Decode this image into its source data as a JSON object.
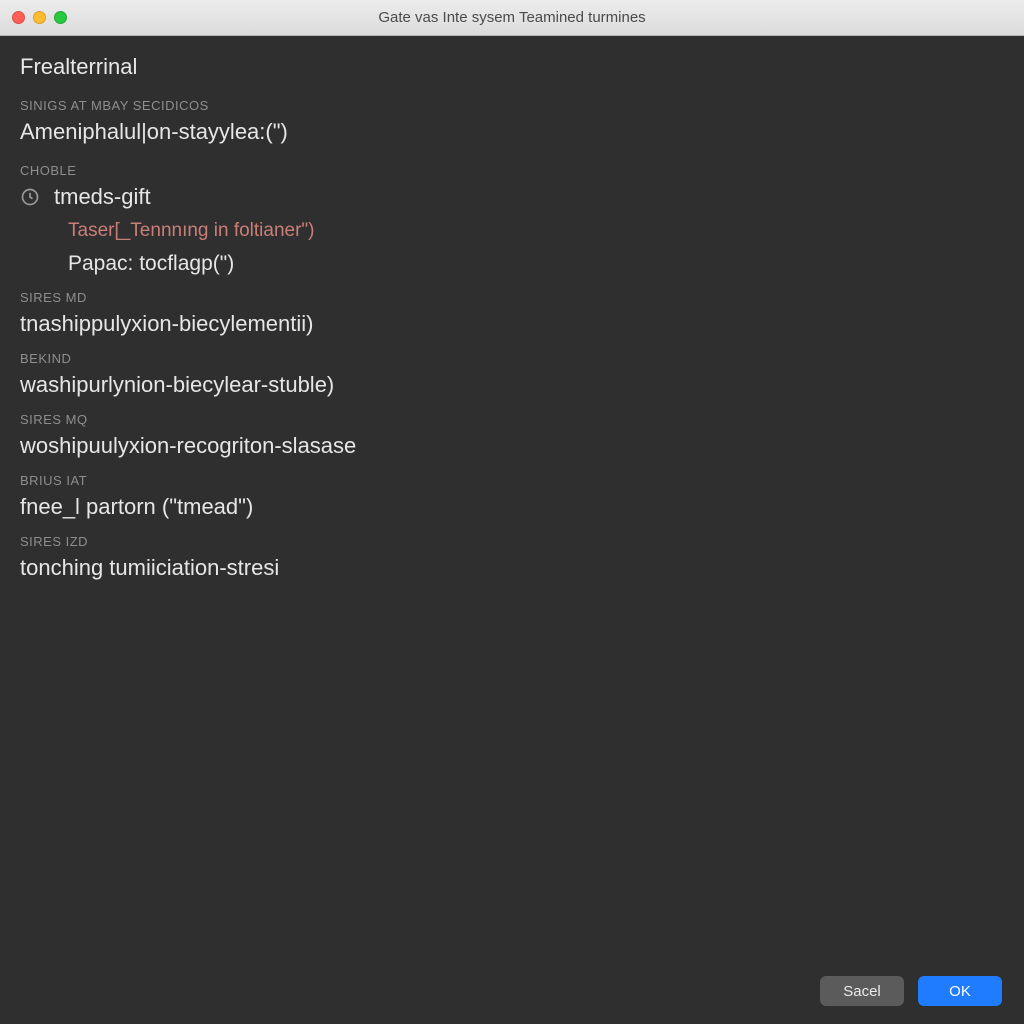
{
  "titlebar": {
    "title": "Gate vas Inte sysem Teamined turmines"
  },
  "heading": "Frealterrinal",
  "sections": [
    {
      "label": "SINIGS AT MBAY SECIDICOS",
      "item": "Ameniphalul|on-stayylea:(\")"
    },
    {
      "label": "CHOBLE",
      "choble": {
        "row1": "tmeds-gift",
        "sub": "Taser[_Tennnıng in foltianer\")",
        "sub2": "Papac: tocflagp(\")"
      }
    },
    {
      "label": "SIRES MD",
      "item": "tnashippulyxion-biecylementii)"
    },
    {
      "label": "BEKIND",
      "item": "washipurlynion-biecylear-stuble)"
    },
    {
      "label": "SIRES MQ",
      "item": "woshipuulyxion-recogriton-slasase"
    },
    {
      "label": "BRIUS IAT",
      "item": "fnee_l partorn (\"tmead\")"
    },
    {
      "label": "SIRES IZD",
      "item": "tonching  tumiiciation-stresi"
    }
  ],
  "footer": {
    "cancel": "Sacel",
    "ok": "OK"
  }
}
